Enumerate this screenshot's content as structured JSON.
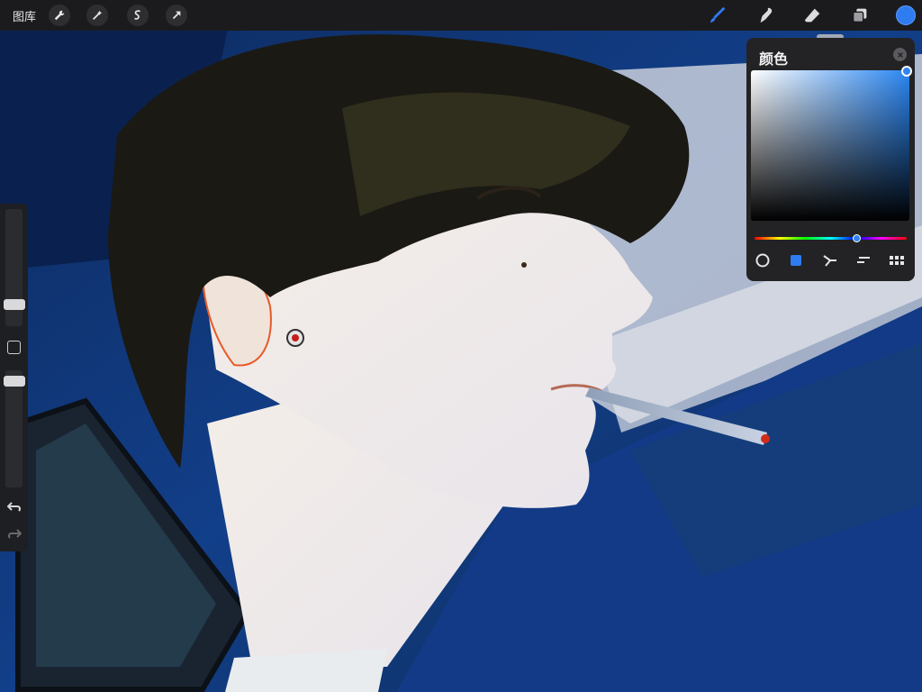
{
  "app": "Procreate",
  "topbar": {
    "gallery_label": "图库",
    "left_tools": [
      "wrench-icon",
      "magic-wand-icon",
      "selection-icon",
      "transform-arrow-icon"
    ],
    "right_tools": [
      "brush-icon",
      "smudge-icon",
      "eraser-icon",
      "layers-icon"
    ],
    "current_color": "#2f7cf0"
  },
  "color_panel": {
    "title": "颜色",
    "selected_color": "#2f84f1",
    "hue_fraction": 0.67,
    "modes": [
      "disc",
      "classic",
      "harmony",
      "value",
      "palettes"
    ],
    "active_mode": "classic"
  },
  "sidebar": {
    "brush_size_level": 0.55,
    "opacity_level": 0.18
  }
}
